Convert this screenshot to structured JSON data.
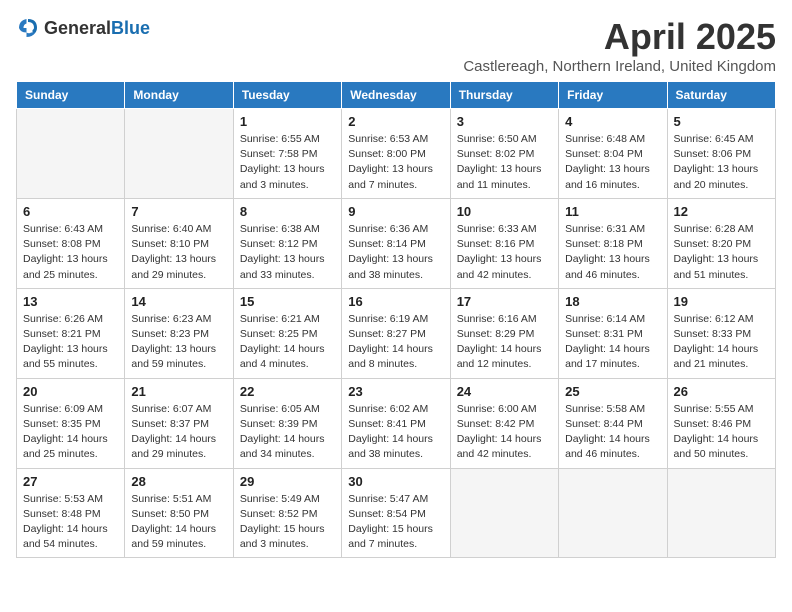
{
  "header": {
    "logo_general": "General",
    "logo_blue": "Blue",
    "month_title": "April 2025",
    "subtitle": "Castlereagh, Northern Ireland, United Kingdom"
  },
  "weekdays": [
    "Sunday",
    "Monday",
    "Tuesday",
    "Wednesday",
    "Thursday",
    "Friday",
    "Saturday"
  ],
  "weeks": [
    [
      {
        "day": "",
        "detail": ""
      },
      {
        "day": "",
        "detail": ""
      },
      {
        "day": "1",
        "detail": "Sunrise: 6:55 AM\nSunset: 7:58 PM\nDaylight: 13 hours\nand 3 minutes."
      },
      {
        "day": "2",
        "detail": "Sunrise: 6:53 AM\nSunset: 8:00 PM\nDaylight: 13 hours\nand 7 minutes."
      },
      {
        "day": "3",
        "detail": "Sunrise: 6:50 AM\nSunset: 8:02 PM\nDaylight: 13 hours\nand 11 minutes."
      },
      {
        "day": "4",
        "detail": "Sunrise: 6:48 AM\nSunset: 8:04 PM\nDaylight: 13 hours\nand 16 minutes."
      },
      {
        "day": "5",
        "detail": "Sunrise: 6:45 AM\nSunset: 8:06 PM\nDaylight: 13 hours\nand 20 minutes."
      }
    ],
    [
      {
        "day": "6",
        "detail": "Sunrise: 6:43 AM\nSunset: 8:08 PM\nDaylight: 13 hours\nand 25 minutes."
      },
      {
        "day": "7",
        "detail": "Sunrise: 6:40 AM\nSunset: 8:10 PM\nDaylight: 13 hours\nand 29 minutes."
      },
      {
        "day": "8",
        "detail": "Sunrise: 6:38 AM\nSunset: 8:12 PM\nDaylight: 13 hours\nand 33 minutes."
      },
      {
        "day": "9",
        "detail": "Sunrise: 6:36 AM\nSunset: 8:14 PM\nDaylight: 13 hours\nand 38 minutes."
      },
      {
        "day": "10",
        "detail": "Sunrise: 6:33 AM\nSunset: 8:16 PM\nDaylight: 13 hours\nand 42 minutes."
      },
      {
        "day": "11",
        "detail": "Sunrise: 6:31 AM\nSunset: 8:18 PM\nDaylight: 13 hours\nand 46 minutes."
      },
      {
        "day": "12",
        "detail": "Sunrise: 6:28 AM\nSunset: 8:20 PM\nDaylight: 13 hours\nand 51 minutes."
      }
    ],
    [
      {
        "day": "13",
        "detail": "Sunrise: 6:26 AM\nSunset: 8:21 PM\nDaylight: 13 hours\nand 55 minutes."
      },
      {
        "day": "14",
        "detail": "Sunrise: 6:23 AM\nSunset: 8:23 PM\nDaylight: 13 hours\nand 59 minutes."
      },
      {
        "day": "15",
        "detail": "Sunrise: 6:21 AM\nSunset: 8:25 PM\nDaylight: 14 hours\nand 4 minutes."
      },
      {
        "day": "16",
        "detail": "Sunrise: 6:19 AM\nSunset: 8:27 PM\nDaylight: 14 hours\nand 8 minutes."
      },
      {
        "day": "17",
        "detail": "Sunrise: 6:16 AM\nSunset: 8:29 PM\nDaylight: 14 hours\nand 12 minutes."
      },
      {
        "day": "18",
        "detail": "Sunrise: 6:14 AM\nSunset: 8:31 PM\nDaylight: 14 hours\nand 17 minutes."
      },
      {
        "day": "19",
        "detail": "Sunrise: 6:12 AM\nSunset: 8:33 PM\nDaylight: 14 hours\nand 21 minutes."
      }
    ],
    [
      {
        "day": "20",
        "detail": "Sunrise: 6:09 AM\nSunset: 8:35 PM\nDaylight: 14 hours\nand 25 minutes."
      },
      {
        "day": "21",
        "detail": "Sunrise: 6:07 AM\nSunset: 8:37 PM\nDaylight: 14 hours\nand 29 minutes."
      },
      {
        "day": "22",
        "detail": "Sunrise: 6:05 AM\nSunset: 8:39 PM\nDaylight: 14 hours\nand 34 minutes."
      },
      {
        "day": "23",
        "detail": "Sunrise: 6:02 AM\nSunset: 8:41 PM\nDaylight: 14 hours\nand 38 minutes."
      },
      {
        "day": "24",
        "detail": "Sunrise: 6:00 AM\nSunset: 8:42 PM\nDaylight: 14 hours\nand 42 minutes."
      },
      {
        "day": "25",
        "detail": "Sunrise: 5:58 AM\nSunset: 8:44 PM\nDaylight: 14 hours\nand 46 minutes."
      },
      {
        "day": "26",
        "detail": "Sunrise: 5:55 AM\nSunset: 8:46 PM\nDaylight: 14 hours\nand 50 minutes."
      }
    ],
    [
      {
        "day": "27",
        "detail": "Sunrise: 5:53 AM\nSunset: 8:48 PM\nDaylight: 14 hours\nand 54 minutes."
      },
      {
        "day": "28",
        "detail": "Sunrise: 5:51 AM\nSunset: 8:50 PM\nDaylight: 14 hours\nand 59 minutes."
      },
      {
        "day": "29",
        "detail": "Sunrise: 5:49 AM\nSunset: 8:52 PM\nDaylight: 15 hours\nand 3 minutes."
      },
      {
        "day": "30",
        "detail": "Sunrise: 5:47 AM\nSunset: 8:54 PM\nDaylight: 15 hours\nand 7 minutes."
      },
      {
        "day": "",
        "detail": ""
      },
      {
        "day": "",
        "detail": ""
      },
      {
        "day": "",
        "detail": ""
      }
    ]
  ]
}
